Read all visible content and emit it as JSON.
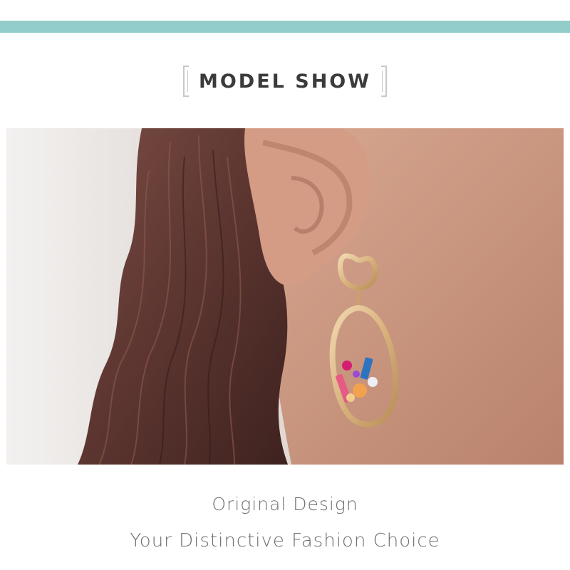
{
  "header": {
    "accent_color": "#93cdcb",
    "title": "MODEL SHOW"
  },
  "photo": {
    "subject": "model ear with gold earring"
  },
  "captions": {
    "line1": "Original Design",
    "line2": "Your Distinctive Fashion Choice"
  }
}
